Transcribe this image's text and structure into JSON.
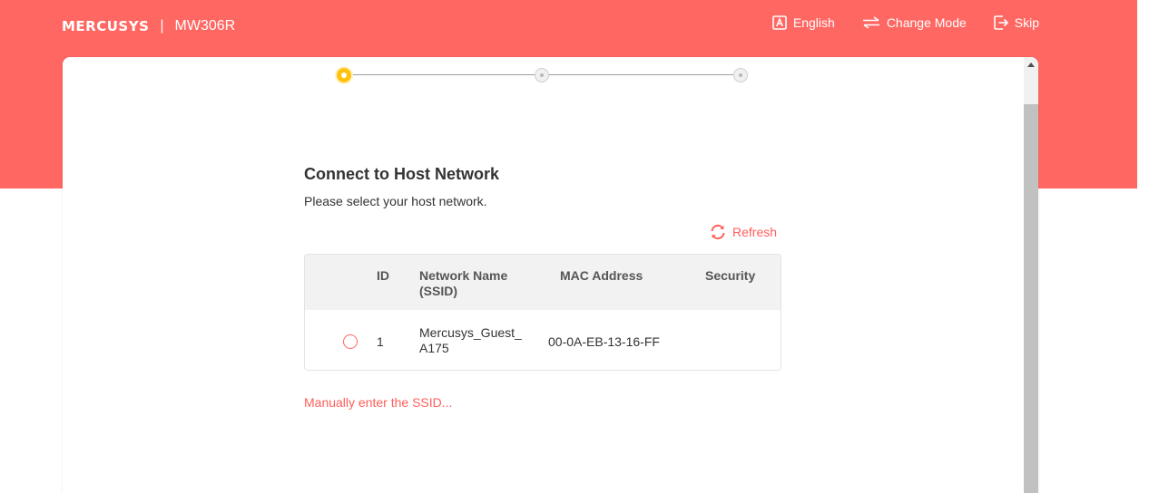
{
  "header": {
    "logo": "MERCUSYS",
    "separator": "|",
    "model": "MW306R",
    "actions": [
      {
        "label": "English",
        "icon": "language-icon"
      },
      {
        "label": "Change Mode",
        "icon": "change-mode-icon"
      },
      {
        "label": "Skip",
        "icon": "skip-icon"
      }
    ]
  },
  "stepper": {
    "current_step": 1,
    "total_steps": 3
  },
  "page": {
    "title": "Connect to Host Network",
    "subtitle": "Please select your host network.",
    "refresh_label": "Refresh",
    "manual_link": "Manually enter the SSID..."
  },
  "table": {
    "headers": {
      "id": "ID",
      "ssid": "Network Name (SSID)",
      "mac": "MAC Address",
      "security": "Security"
    },
    "rows": [
      {
        "id": "1",
        "ssid": "Mercusys_Guest_A175",
        "mac": "00-0A-EB-13-16-FF",
        "security": "",
        "selected": false
      }
    ]
  },
  "colors": {
    "brand": "#ff6762",
    "accent_text": "#ff5e5a",
    "step_active": "#ffc20e"
  }
}
